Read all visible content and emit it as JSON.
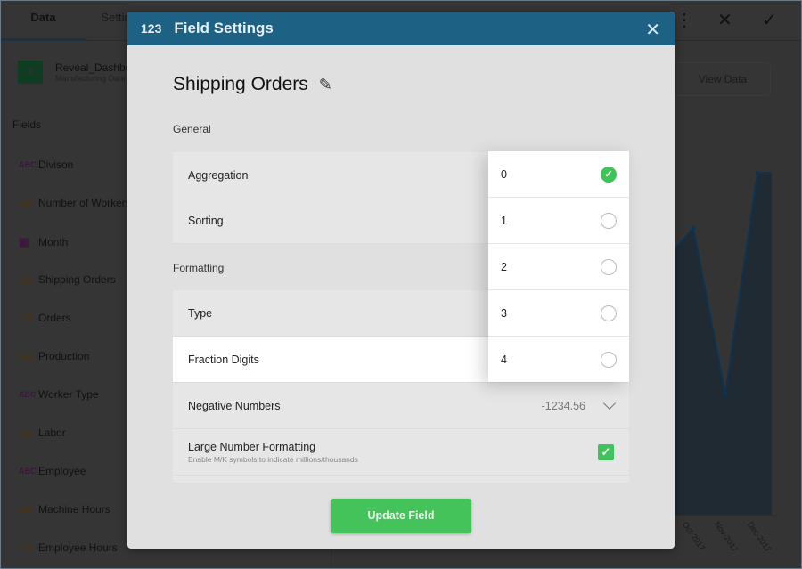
{
  "tabs": [
    {
      "label": "Data"
    },
    {
      "label": "Settings"
    }
  ],
  "source": {
    "title": "Reveal_Dashboard",
    "subtitle": "Manufacturing Data",
    "icon": "excel-icon",
    "icon_text": "X"
  },
  "fields_header": "Fields",
  "fields": [
    {
      "type": "ABC",
      "label": "Divison"
    },
    {
      "type": "123",
      "label": "Number of Workers"
    },
    {
      "type": "calendar",
      "label": "Month"
    },
    {
      "type": "123",
      "label": "Shipping Orders"
    },
    {
      "type": "123",
      "label": "Orders"
    },
    {
      "type": "123",
      "label": "Production"
    },
    {
      "type": "ABC",
      "label": "Worker Type"
    },
    {
      "type": "123",
      "label": "Labor"
    },
    {
      "type": "ABC",
      "label": "Employee"
    },
    {
      "type": "123",
      "label": "Machine Hours"
    },
    {
      "type": "123",
      "label": "Employee Hours"
    }
  ],
  "toolbar": {
    "more": "⋮",
    "close": "✕",
    "confirm": "✓"
  },
  "view_data": "View Data",
  "chart_axis_labels": [
    "Oct-2017",
    "Nov-2017",
    "Dec-2017"
  ],
  "dialog": {
    "type_badge": "123",
    "title": "Field Settings",
    "close": "✕",
    "field_name": "Shipping Orders",
    "general_label": "General",
    "aggregation": "Aggregation",
    "sorting": "Sorting",
    "formatting_label": "Formatting",
    "type": "Type",
    "fraction_digits": "Fraction Digits",
    "negative_numbers": "Negative Numbers",
    "negative_value": "-1234.56",
    "large_number": "Large Number Formatting",
    "large_number_sub": "Enable M/K symbols to indicate millions/thousands",
    "large_number_checked": true,
    "update_button": "Update Field",
    "fraction_options": [
      "0",
      "1",
      "2",
      "3",
      "4"
    ],
    "fraction_selected": "0"
  },
  "colors": {
    "header": "#1d6285",
    "accent": "#43c35a"
  }
}
